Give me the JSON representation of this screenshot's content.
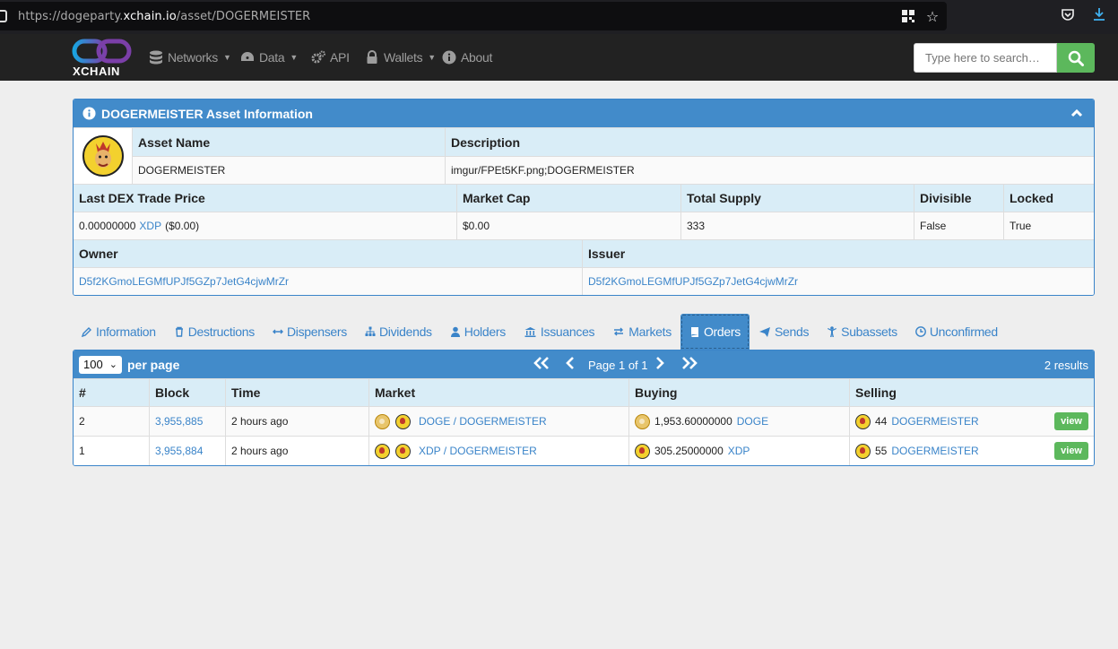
{
  "browser": {
    "url_prefix": "https://dogeparty.",
    "url_domain": "xchain.io",
    "url_path": "/asset/DOGERMEISTER"
  },
  "nav": {
    "logo_text": "XCHAIN",
    "networks": "Networks",
    "data": "Data",
    "api": "API",
    "wallets": "Wallets",
    "about": "About",
    "search_placeholder": "Type here to search…"
  },
  "asset_panel": {
    "title": "DOGERMEISTER Asset Information",
    "asset_name_label": "Asset Name",
    "asset_name": "DOGERMEISTER",
    "description_label": "Description",
    "description": "imgur/FPEt5KF.png;DOGERMEISTER",
    "last_price_label": "Last DEX Trade Price",
    "last_price_value": "0.00000000",
    "last_price_unit": "XDP",
    "last_price_usd": "($0.00)",
    "market_cap_label": "Market Cap",
    "market_cap": "$0.00",
    "total_supply_label": "Total Supply",
    "total_supply": "333",
    "divisible_label": "Divisible",
    "divisible": "False",
    "locked_label": "Locked",
    "locked": "True",
    "owner_label": "Owner",
    "owner": "D5f2KGmoLEGMfUPJf5GZp7JetG4cjwMrZr",
    "issuer_label": "Issuer",
    "issuer": "D5f2KGmoLEGMfUPJf5GZp7JetG4cjwMrZr"
  },
  "tabs": [
    {
      "label": "Information",
      "icon": "pencil-icon"
    },
    {
      "label": "Destructions",
      "icon": "trash-icon"
    },
    {
      "label": "Dispensers",
      "icon": "arrows-h-icon"
    },
    {
      "label": "Dividends",
      "icon": "sitemap-icon"
    },
    {
      "label": "Holders",
      "icon": "user-icon"
    },
    {
      "label": "Issuances",
      "icon": "bank-icon"
    },
    {
      "label": "Markets",
      "icon": "exchange-icon"
    },
    {
      "label": "Orders",
      "icon": "book-icon"
    },
    {
      "label": "Sends",
      "icon": "send-icon"
    },
    {
      "label": "Subassets",
      "icon": "child-icon"
    },
    {
      "label": "Unconfirmed",
      "icon": "clock-icon"
    }
  ],
  "active_tab": "Orders",
  "orders": {
    "per_page": "100",
    "per_page_label": "per page",
    "page_text": "Page 1 of 1",
    "results": "2 results",
    "headers": [
      "#",
      "Block",
      "Time",
      "Market",
      "Buying",
      "Selling"
    ],
    "rows": [
      {
        "num": "2",
        "block": "3,955,885",
        "time": "2 hours ago",
        "market": "DOGE / DOGERMEISTER",
        "buy_amount": "1,953.60000000",
        "buy_asset": "DOGE",
        "sell_amount": "44",
        "sell_asset": "DOGERMEISTER",
        "action": "view"
      },
      {
        "num": "1",
        "block": "3,955,884",
        "time": "2 hours ago",
        "market": "XDP / DOGERMEISTER",
        "buy_amount": "305.25000000",
        "buy_asset": "XDP",
        "sell_amount": "55",
        "sell_asset": "DOGERMEISTER",
        "action": "view"
      }
    ]
  },
  "colors": {
    "primary": "#428bca",
    "link": "#3a84c9",
    "success": "#5cb85c",
    "navbar": "#222222",
    "header_row": "#d9edf7"
  }
}
